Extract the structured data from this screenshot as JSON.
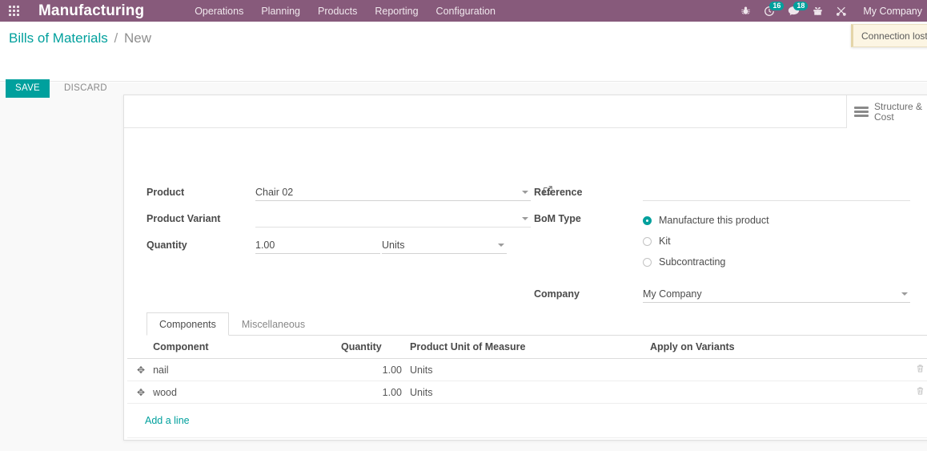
{
  "navbar": {
    "apps_icon": "apps-grid-icon",
    "brand": "Manufacturing",
    "menus": [
      {
        "label": "Operations"
      },
      {
        "label": "Planning"
      },
      {
        "label": "Products"
      },
      {
        "label": "Reporting"
      },
      {
        "label": "Configuration"
      }
    ],
    "icons": [
      {
        "name": "bug-icon",
        "badge": ""
      },
      {
        "name": "activity-clock-icon",
        "badge": "16"
      },
      {
        "name": "messages-icon",
        "badge": "18"
      },
      {
        "name": "gift-icon",
        "badge": ""
      },
      {
        "name": "tools-icon",
        "badge": ""
      }
    ],
    "user": "My Company",
    "bg_color": "#875A7B"
  },
  "notification": {
    "text": "Connection lost."
  },
  "breadcrumb": {
    "root": "Bills of Materials",
    "separator": "/",
    "current": "New"
  },
  "actions": {
    "save": "SAVE",
    "discard": "DISCARD",
    "save_color": "#00A09D"
  },
  "stat_button": {
    "label": "Structure & Cost",
    "icon": "list-lines-icon"
  },
  "form": {
    "left": {
      "product": {
        "label": "Product",
        "value": "Chair 02",
        "placeholder": ""
      },
      "product_variant": {
        "label": "Product Variant",
        "value": "",
        "placeholder": ""
      },
      "quantity": {
        "label": "Quantity",
        "value": "1.00",
        "uom": "Units"
      }
    },
    "right": {
      "reference": {
        "label": "Reference",
        "value": "",
        "placeholder": ""
      },
      "bom_type": {
        "label": "BoM Type",
        "options": [
          {
            "label": "Manufacture this product",
            "selected": true
          },
          {
            "label": "Kit",
            "selected": false
          },
          {
            "label": "Subcontracting",
            "selected": false
          }
        ]
      },
      "company": {
        "label": "Company",
        "value": "My Company"
      }
    }
  },
  "notebook": {
    "tabs": [
      {
        "label": "Components",
        "active": true
      },
      {
        "label": "Miscellaneous",
        "active": false
      }
    ]
  },
  "table": {
    "headers": {
      "component": "Component",
      "quantity": "Quantity",
      "uom": "Product Unit of Measure",
      "variants": "Apply on Variants"
    },
    "rows": [
      {
        "component": "nail",
        "quantity": "1.00",
        "uom": "Units",
        "variants": ""
      },
      {
        "component": "wood",
        "quantity": "1.00",
        "uom": "Units",
        "variants": ""
      }
    ],
    "add_line": "Add a line"
  }
}
